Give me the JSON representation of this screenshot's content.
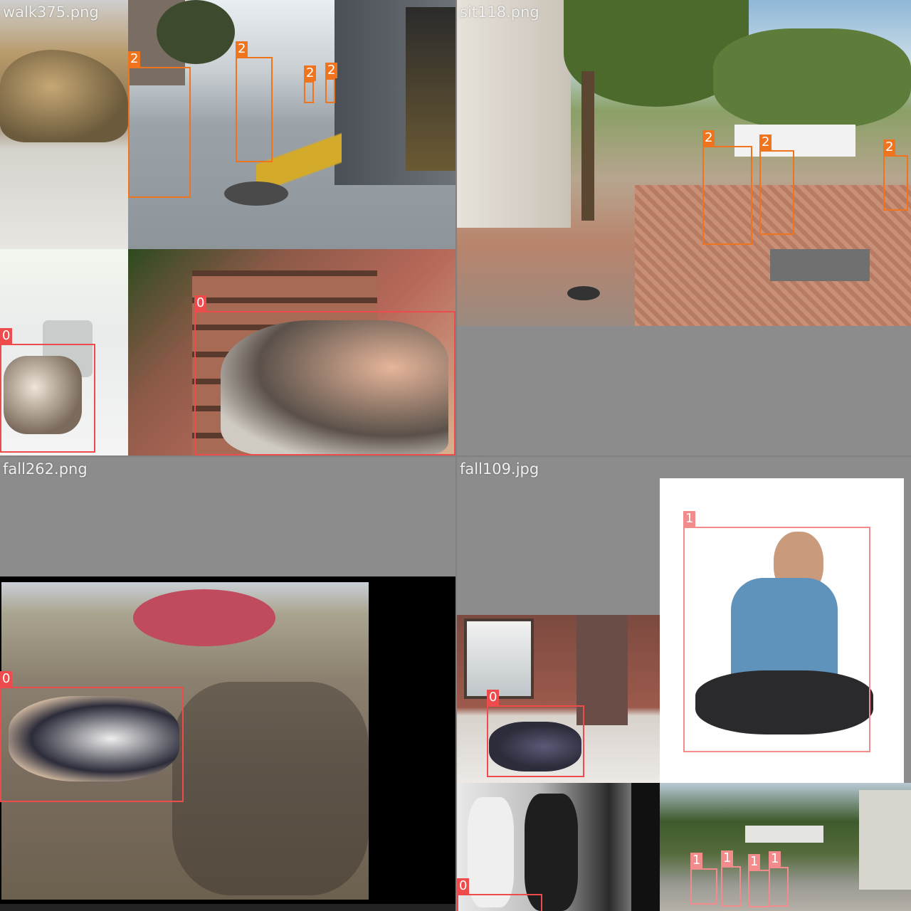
{
  "mosaic": {
    "tiles": [
      {
        "filename": "walk375.png"
      },
      {
        "filename": "sit118.png"
      },
      {
        "filename": "fall262.png"
      },
      {
        "filename": "fall109.jpg"
      }
    ]
  },
  "classes": {
    "0": {
      "label": "0",
      "color": "#ee4c4c"
    },
    "1": {
      "label": "1",
      "color": "#f28c8c"
    },
    "2": {
      "label": "2",
      "color": "#f0741e"
    }
  },
  "detections": {
    "walk_a": "2",
    "walk_b": "2",
    "walk_c": "2",
    "walk_d": "2",
    "tl_fall_man": "0",
    "tl_fall_woman": "0",
    "sit_a": "2",
    "sit_b": "2",
    "sit_c": "2",
    "fall262_child": "0",
    "fall109_floor": "0",
    "fall109_seated": "1",
    "cafe_a": "1",
    "cafe_b": "1",
    "cafe_c": "1",
    "cafe_d": "1",
    "street_fall": "0"
  }
}
